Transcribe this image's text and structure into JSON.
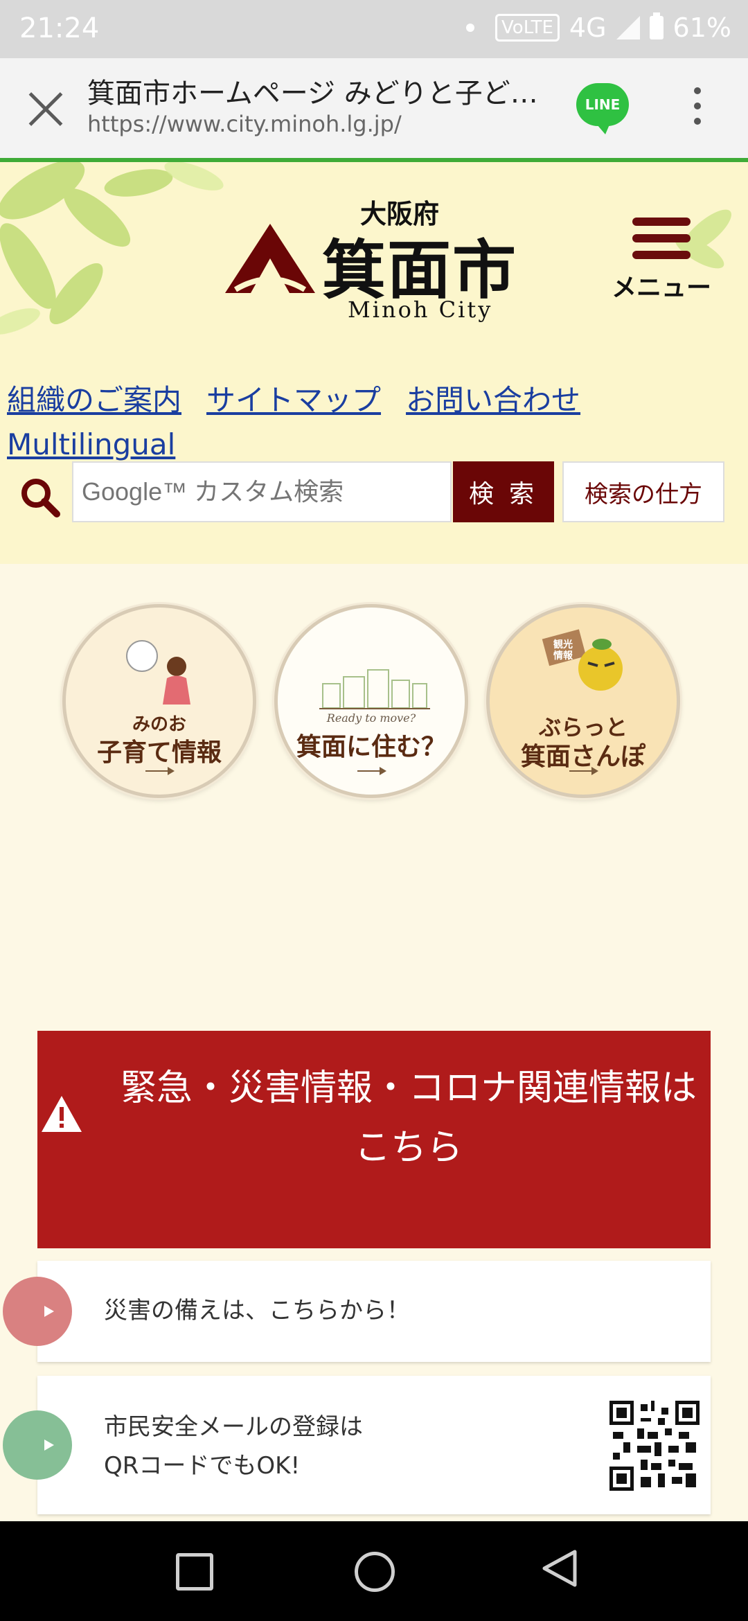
{
  "status_bar": {
    "time": "21:24",
    "volte": "VoLTE",
    "network": "4G",
    "battery": "61%"
  },
  "browser": {
    "page_title": "箕面市ホームページ みどりと子ど…",
    "url": "https://www.city.minoh.lg.jp/",
    "line_label": "LINE"
  },
  "header": {
    "prefecture": "大阪府",
    "city_name": "箕面市",
    "city_name_en": "Minoh City",
    "menu_label": "メニュー"
  },
  "links": {
    "organization": "組織のご案内",
    "sitemap": "サイトマップ",
    "contact": "お問い合わせ",
    "multilingual": "Multilingual"
  },
  "search": {
    "placeholder": "Google™ カスタム検索",
    "button": "検 索",
    "howto": "検索の仕方"
  },
  "features": {
    "childcare_small": "みのお",
    "childcare_big": "子育て情報",
    "living_small": "Ready to move?",
    "living_big": "箕面に住む？",
    "walk_small": "ぶらっと",
    "walk_big": "箕面さんぽ",
    "walk_sign": "観光情報"
  },
  "emergency": {
    "text": "緊急・災害情報・コロナ関連情報はこちら"
  },
  "cards": {
    "disaster_prep": "災害の備えは、こちらから！",
    "mail_line1": "市民安全メールの登録は",
    "mail_line2": "QRコードでもOK!"
  },
  "colors": {
    "header_bg": "#fcf6cc",
    "page_bg": "#fdf8e5",
    "brand_maroon": "#6a0606",
    "emergency_red": "#b01b1b",
    "link_blue": "#1a3ea0",
    "browser_accent": "#3fab37"
  }
}
